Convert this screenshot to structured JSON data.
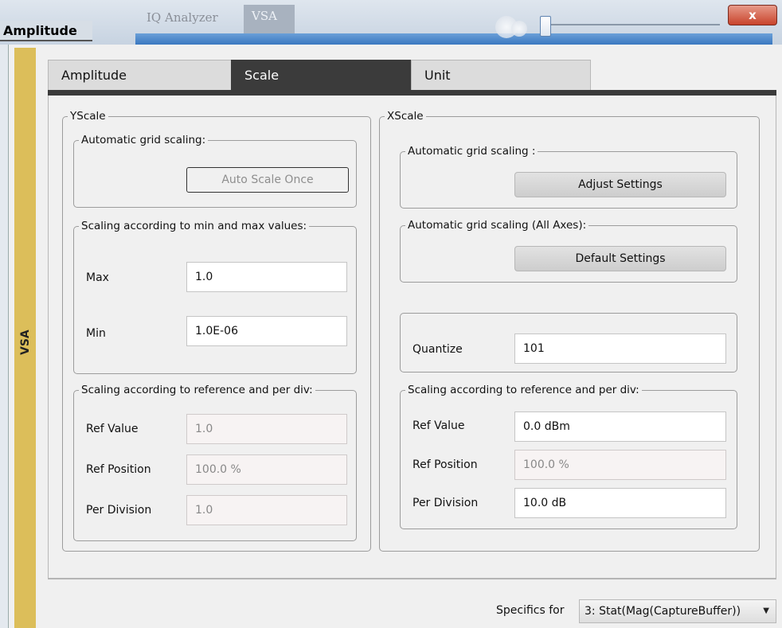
{
  "window": {
    "title": "Amplitude",
    "app_tabs": [
      "IQ Analyzer",
      "VSA"
    ],
    "close_glyph": "x"
  },
  "sidebar": {
    "label": "VSA",
    "color": "#dcbe5a"
  },
  "tabs": [
    {
      "label": "Amplitude",
      "active": false
    },
    {
      "label": "Scale",
      "active": true
    },
    {
      "label": "Unit",
      "active": false
    }
  ],
  "yscale": {
    "title": "YScale",
    "auto_grid": {
      "title": "Automatic grid scaling:",
      "button_label": "Auto Scale Once"
    },
    "minmax": {
      "title": "Scaling according to min and max values:",
      "max_label": "Max",
      "max_value": "1.0",
      "min_label": "Min",
      "min_value": "1.0E-06"
    },
    "refdiv": {
      "title": "Scaling according to reference and per div:",
      "ref_value_label": "Ref Value",
      "ref_value": "1.0",
      "ref_position_label": "Ref Position",
      "ref_position": "100.0 %",
      "per_division_label": "Per Division",
      "per_division": "1.0"
    }
  },
  "xscale": {
    "title": "XScale",
    "auto_grid": {
      "title": "Automatic grid scaling :",
      "button_label": "Adjust Settings"
    },
    "auto_grid_all": {
      "title": "Automatic grid scaling (All Axes):",
      "button_label": "Default Settings"
    },
    "quantize": {
      "label": "Quantize",
      "value": "101"
    },
    "refdiv": {
      "title": "Scaling according to reference and per div:",
      "ref_value_label": "Ref Value",
      "ref_value": "0.0 dBm",
      "ref_position_label": "Ref Position",
      "ref_position": "100.0 %",
      "per_division_label": "Per Division",
      "per_division": "10.0 dB"
    }
  },
  "footer": {
    "specifics_label": "Specifics for",
    "specifics_value": "3: Stat(Mag(CaptureBuffer))"
  }
}
